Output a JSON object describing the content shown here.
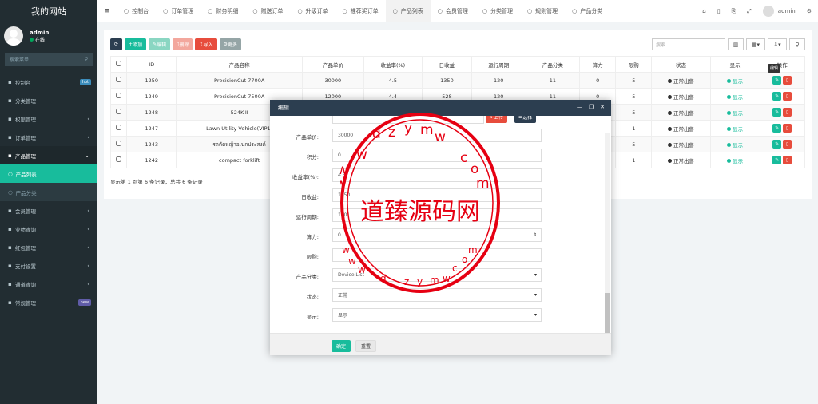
{
  "sidebar": {
    "brand": "我的网站",
    "user": "admin",
    "status": "在线",
    "search_placeholder": "搜索菜单",
    "items": [
      {
        "label": "控制台",
        "badge": "hot",
        "badge_color": "#3c8dbc"
      },
      {
        "label": "分类管理"
      },
      {
        "label": "权限管理",
        "chev": "‹"
      },
      {
        "label": "订单管理",
        "chev": "‹"
      },
      {
        "label": "产品管理",
        "chev": "⌄"
      }
    ],
    "subitems": [
      {
        "label": "产品列表"
      },
      {
        "label": "产品分类"
      }
    ],
    "items2": [
      {
        "label": "会员管理",
        "chev": "‹"
      },
      {
        "label": "业绩查询",
        "chev": "‹"
      },
      {
        "label": "红包管理",
        "chev": "‹"
      },
      {
        "label": "支付设置",
        "chev": "‹"
      },
      {
        "label": "通道查询",
        "chev": "‹"
      },
      {
        "label": "常规管理",
        "badge": "new",
        "badge_color": "#605ca8"
      }
    ]
  },
  "topbar": {
    "tabs": [
      "控制台",
      "订单管理",
      "财务明细",
      "赠送订单",
      "升级订单",
      "推荐奖订单",
      "产品列表",
      "会员管理",
      "分类管理",
      "规则管理",
      "产品分类"
    ],
    "active_tab": "产品列表",
    "user": "admin"
  },
  "toolbar": {
    "add": "添加",
    "edit": "编辑",
    "delete": "删除",
    "import": "导入",
    "more": "更多",
    "search_placeholder": "搜索"
  },
  "table": {
    "headers": [
      "ID",
      "产品名称",
      "产品单价",
      "收益率(%)",
      "日收益",
      "运行周期",
      "产品分类",
      "算力",
      "限购",
      "状态",
      "显示",
      "操作"
    ],
    "rows": [
      [
        "1250",
        "PrecisionCut 7700A",
        "30000",
        "4.5",
        "1350",
        "120",
        "11",
        "0",
        "5",
        "正常出售",
        "显示"
      ],
      [
        "1249",
        "PrecisionCut 7500A",
        "12000",
        "4.4",
        "528",
        "120",
        "11",
        "0",
        "5",
        "正常出售",
        "显示"
      ],
      [
        "1248",
        "524K-II",
        "",
        "",
        "",
        "",
        "",
        "",
        "5",
        "正常出售",
        "显示"
      ],
      [
        "1247",
        "Lawn Utility Vehicle(VIP1)",
        "",
        "",
        "",
        "",
        "",
        "",
        "1",
        "正常出售",
        "显示"
      ],
      [
        "1243",
        "รถตัดหญ้าอเนกประสงค์",
        "",
        "",
        "",
        "",
        "",
        "",
        "5",
        "正常出售",
        "显示"
      ],
      [
        "1242",
        "compact forklift",
        "",
        "",
        "",
        "",
        "",
        "",
        "1",
        "正常出售",
        "显示"
      ]
    ],
    "pager": "显示第 1 到第 6 条记录，总共 6 条记录",
    "tooltip": "编辑"
  },
  "modal": {
    "title": "编辑",
    "upload": "上传",
    "choose": "选择",
    "fields": [
      {
        "label": "产品单价:",
        "value": "30000"
      },
      {
        "label": "积分:",
        "value": "0"
      },
      {
        "label": "收益率(%):",
        "value": "4.5"
      },
      {
        "label": "日收益:",
        "value": "1350"
      },
      {
        "label": "运行周期:",
        "value": "120"
      },
      {
        "label": "算力:",
        "value": "0"
      },
      {
        "label": "限购:",
        "value": ""
      },
      {
        "label": "产品分类:",
        "value": "Device List"
      },
      {
        "label": "状态:",
        "value": "正常"
      },
      {
        "label": "显示:",
        "value": "显示"
      }
    ],
    "ok": "确定",
    "reset": "重置"
  },
  "stamp": {
    "center": "道臻源码网",
    "ring": "dzym www.com"
  }
}
